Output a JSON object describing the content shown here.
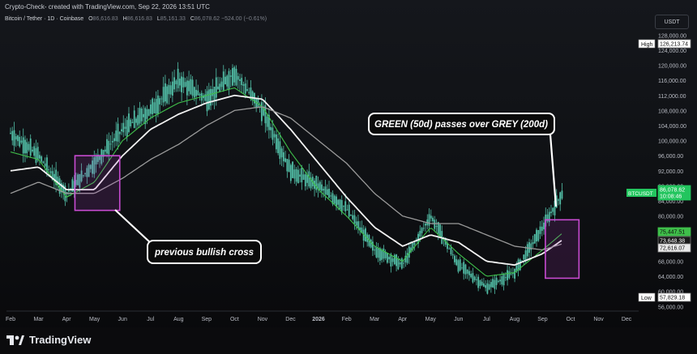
{
  "header": {
    "credit": "Crypto-Check- created with TradingView.com, Sep 22, 2026 13:51 UTC",
    "symbol": "Bitcoin / Tether · 1D · Coinbase",
    "o_label": "O",
    "o_value": "86,616.83",
    "h_label": "H",
    "h_value": "86,616.83",
    "l_label": "L",
    "l_value": "85,161.33",
    "c_label": "C",
    "c_value": "86,078.62",
    "change": "−524.00 (−0.61%)",
    "currency_button": "USDT"
  },
  "brand": {
    "name": "TradingView"
  },
  "colors": {
    "accent_green": "#1ed760",
    "price_tag": "#22c55e",
    "box_border": "#c84bd1",
    "ma50": "#3fbf4a",
    "ma100": "#f2f2f2",
    "ma200": "#9a9a9a",
    "candle": "#52bfa7"
  },
  "annotations": {
    "left_label": "previous bullish cross",
    "right_label": "GREEN (50d) passes over GREY (200d)"
  },
  "price_tags": {
    "high_label": "High",
    "high_value": "126,213.74",
    "low_label": "Low",
    "low_value": "57,829.18",
    "current_symbol": "BTCUSDT",
    "current_value": "86,078.62",
    "countdown": "10:08:46",
    "ma50_value": "75,447.51",
    "ma100_value": "73,648.38",
    "ma200_value": "72,616.07"
  },
  "chart_data": {
    "type": "line",
    "title": "Bitcoin / Tether · 1D · Coinbase",
    "xlabel": "",
    "ylabel": "",
    "x_ticks": [
      "Feb",
      "Mar",
      "Apr",
      "May",
      "Jun",
      "Jul",
      "Aug",
      "Sep",
      "Oct",
      "Nov",
      "Dec",
      "2026",
      "Feb",
      "Mar",
      "Apr",
      "May",
      "Jun",
      "Jul",
      "Aug",
      "Sep",
      "Oct",
      "Nov",
      "Dec"
    ],
    "y_ticks": [
      56000,
      60000,
      64000,
      68000,
      72000,
      76000,
      80000,
      84000,
      88000,
      92000,
      96000,
      100000,
      104000,
      108000,
      112000,
      116000,
      120000,
      124000,
      128000
    ],
    "ylim": [
      55000,
      130000
    ],
    "grid": false,
    "x_months": [
      0,
      1,
      2,
      3,
      4,
      5,
      6,
      7,
      8,
      9,
      10,
      11,
      12,
      13,
      14,
      15,
      16,
      17,
      18,
      19,
      20,
      21,
      22
    ],
    "series": [
      {
        "values": [
          102000,
          96000,
          86000,
          94000,
          103000,
          108000,
          116000,
          111000,
          118000,
          108000,
          92000,
          88000,
          82000,
          71000,
          67000,
          80000,
          67000,
          61000,
          65000,
          77000,
          86000
        ]
      },
      {
        "values": [
          97000,
          95000,
          85000,
          89000,
          100000,
          106000,
          110000,
          112000,
          114000,
          109000,
          97000,
          87000,
          80000,
          72000,
          68000,
          77000,
          70000,
          64000,
          65000,
          71000,
          75400
        ]
      },
      {
        "values": [
          92000,
          93000,
          87000,
          87000,
          96000,
          103000,
          107000,
          110000,
          112000,
          111000,
          103000,
          94000,
          85000,
          77000,
          72000,
          75000,
          73000,
          68000,
          67000,
          70000,
          73600
        ]
      },
      {
        "values": [
          86000,
          89000,
          86000,
          86000,
          90000,
          95000,
          99000,
          104000,
          108000,
          109000,
          106000,
          100000,
          94000,
          86000,
          80000,
          78000,
          78000,
          75000,
          72000,
          71000,
          72600
        ]
      }
    ],
    "series_x": [
      0,
      1,
      2,
      3,
      4,
      5,
      6,
      7,
      8,
      9,
      10,
      11,
      12,
      13,
      14,
      15,
      16,
      17,
      18,
      19,
      19.7
    ],
    "highlight_boxes": [
      {
        "x_start": 2.3,
        "x_end": 3.9,
        "y_low": 81500,
        "y_high": 96000
      },
      {
        "x_start": 19.1,
        "x_end": 20.3,
        "y_low": 63500,
        "y_high": 79000
      }
    ]
  }
}
